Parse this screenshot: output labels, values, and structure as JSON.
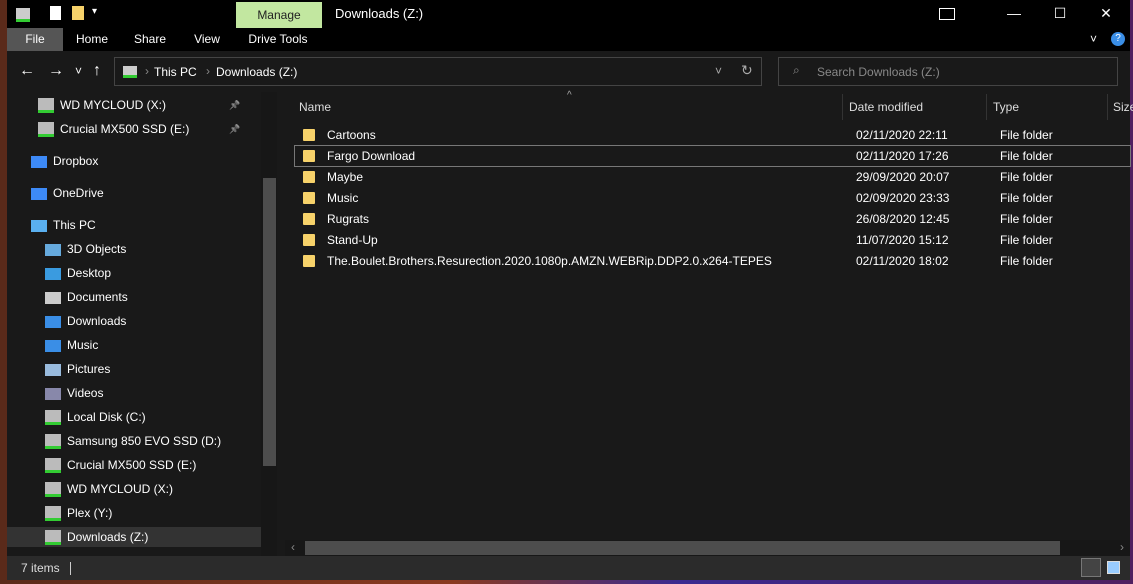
{
  "window": {
    "title": "Downloads (Z:)",
    "contextual_tab": "Manage",
    "minimize": "—",
    "maximize": "☐",
    "close": "✕"
  },
  "ribbon": {
    "tabs": [
      "File",
      "Home",
      "Share",
      "View",
      "Drive Tools"
    ]
  },
  "nav": {
    "back": "←",
    "forward": "→",
    "recent": "˅",
    "up": "↑",
    "breadcrumb": [
      "This PC",
      "Downloads (Z:)"
    ],
    "search_placeholder": "Search Downloads (Z:)"
  },
  "sidebar": {
    "items": [
      {
        "label": "WD MYCLOUD (X:)",
        "icon": "drive",
        "pinned": true
      },
      {
        "label": "Crucial MX500 SSD (E:)",
        "icon": "drive",
        "pinned": true
      },
      {
        "label": "Dropbox",
        "icon": "dropbox"
      },
      {
        "label": "OneDrive",
        "icon": "cloud"
      },
      {
        "label": "This PC",
        "icon": "pc"
      },
      {
        "label": "3D Objects",
        "icon": "cube"
      },
      {
        "label": "Desktop",
        "icon": "desktop"
      },
      {
        "label": "Documents",
        "icon": "document"
      },
      {
        "label": "Downloads",
        "icon": "download"
      },
      {
        "label": "Music",
        "icon": "music"
      },
      {
        "label": "Pictures",
        "icon": "pictures"
      },
      {
        "label": "Videos",
        "icon": "videos"
      },
      {
        "label": "Local Disk (C:)",
        "icon": "drive"
      },
      {
        "label": "Samsung 850 EVO SSD (D:)",
        "icon": "drive"
      },
      {
        "label": "Crucial MX500 SSD (E:)",
        "icon": "drive"
      },
      {
        "label": "WD MYCLOUD (X:)",
        "icon": "drive"
      },
      {
        "label": "Plex (Y:)",
        "icon": "drive"
      },
      {
        "label": "Downloads (Z:)",
        "icon": "drive",
        "selected": true
      }
    ]
  },
  "columns": {
    "name": "Name",
    "date": "Date modified",
    "type": "Type",
    "size": "Size"
  },
  "files": [
    {
      "name": "Cartoons",
      "date": "02/11/2020 22:11",
      "type": "File folder"
    },
    {
      "name": "Fargo Download",
      "date": "02/11/2020 17:26",
      "type": "File folder"
    },
    {
      "name": "Maybe",
      "date": "29/09/2020 20:07",
      "type": "File folder"
    },
    {
      "name": "Music",
      "date": "02/09/2020 23:33",
      "type": "File folder"
    },
    {
      "name": "Rugrats",
      "date": "26/08/2020 12:45",
      "type": "File folder"
    },
    {
      "name": "Stand-Up",
      "date": "11/07/2020 15:12",
      "type": "File folder"
    },
    {
      "name": "The.Boulet.Brothers.Resurection.2020.1080p.AMZN.WEBRip.DDP2.0.x264-TEPES",
      "date": "02/11/2020 18:02",
      "type": "File folder"
    }
  ],
  "status": {
    "count": "7 items"
  }
}
